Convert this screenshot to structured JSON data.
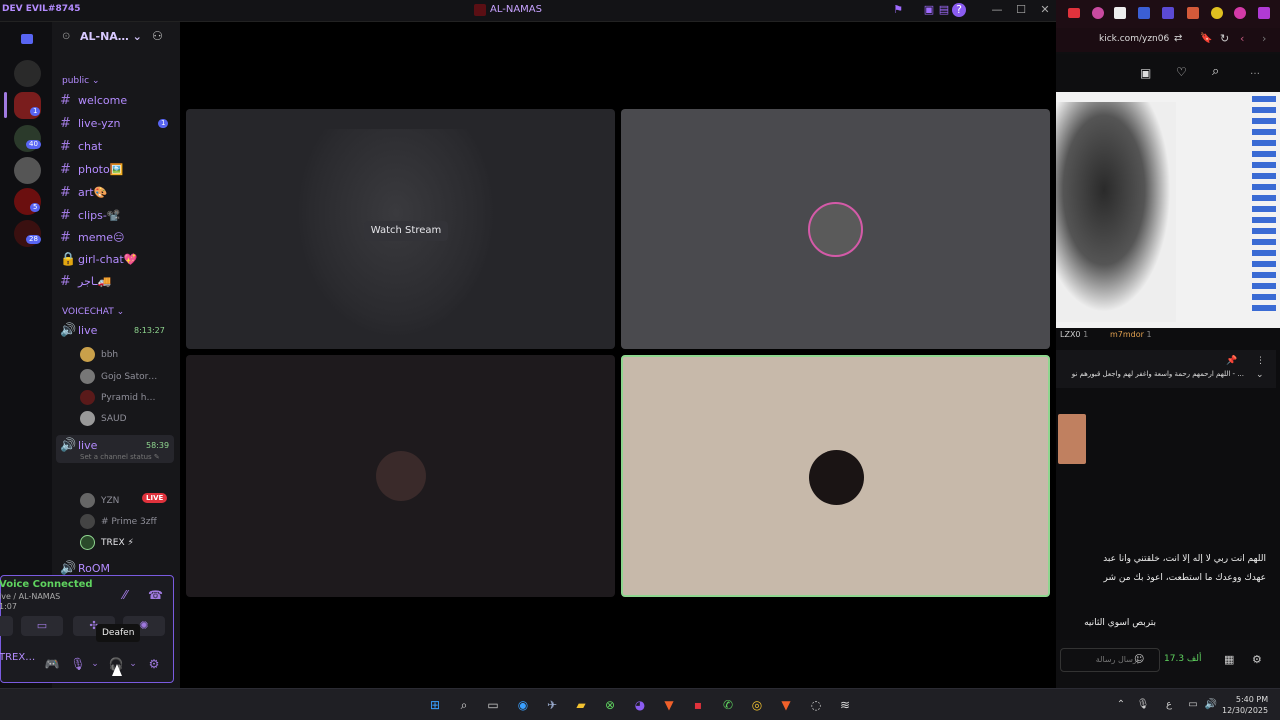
{
  "titlebar": {
    "user_tag": "DEV EVIL#8745",
    "title": "AL-NAMAS"
  },
  "server": {
    "name": "AL-NA…",
    "badges": [
      "1",
      "40",
      "5",
      "28"
    ]
  },
  "categories": {
    "public": "public",
    "voicechat": "VOICECHAT"
  },
  "text_channels": [
    {
      "name": "welcome",
      "badge": ""
    },
    {
      "name": "live-yzn",
      "badge": "1"
    },
    {
      "name": "chat",
      "badge": ""
    },
    {
      "name": "photo🖼️",
      "badge": ""
    },
    {
      "name": "art🎨",
      "badge": ""
    },
    {
      "name": "clips-📽️",
      "badge": ""
    },
    {
      "name": "meme😑",
      "badge": ""
    },
    {
      "name": "girl-chat💖",
      "badge": ""
    },
    {
      "name": "ـاجر🚚",
      "badge": ""
    }
  ],
  "voice_channels": [
    {
      "name": "live",
      "time": "8:13:27",
      "users": [
        "bbh",
        "Gojo Sator…",
        "Pyramid h…",
        "SAUD"
      ]
    },
    {
      "name": "live",
      "time": "58:39",
      "status": "Set a channel status ✎",
      "users": [
        "YZN",
        "# Prime 3zff",
        "TREX ⚡"
      ],
      "live_label": "LIVE"
    },
    {
      "name": "RoOM",
      "time": "",
      "users": []
    }
  ],
  "voice_panel": {
    "status": "Voice Connected",
    "location": "ive / AL-NAMAS",
    "time": "1:07",
    "username": "TREX…"
  },
  "tooltip": "Deafen",
  "stage": {
    "watch_label": "Watch Stream"
  },
  "browser": {
    "url": "kick.com/yzn06",
    "chat_users": [
      {
        "name": "LZX0",
        "count": "1"
      },
      {
        "name": "m7mdor",
        "count": "1"
      }
    ],
    "pinned": "... - اللهم ارحمهم رحمة واسعة واغفر لهم واجعل قبورهم نو",
    "messages": [
      "اللهم أنت ربي لا إله إلا أنت، خلقتني وأنا عبد",
      "عهدك ووعدك ما استطعت، أعوذ بك من شر",
      "بتربص اسوي الثانيه"
    ],
    "input_placeholder": "إرسال رسالة",
    "viewers": "17.3 ألف"
  },
  "taskbar": {
    "time": "5:40 PM",
    "date": "12/30/2025",
    "lang": "ع"
  },
  "colors": {
    "accent": "#a07ae0",
    "live_red": "#e0323c",
    "tile_beige": "#c7b9aa",
    "green_border": "#8fd68f"
  }
}
